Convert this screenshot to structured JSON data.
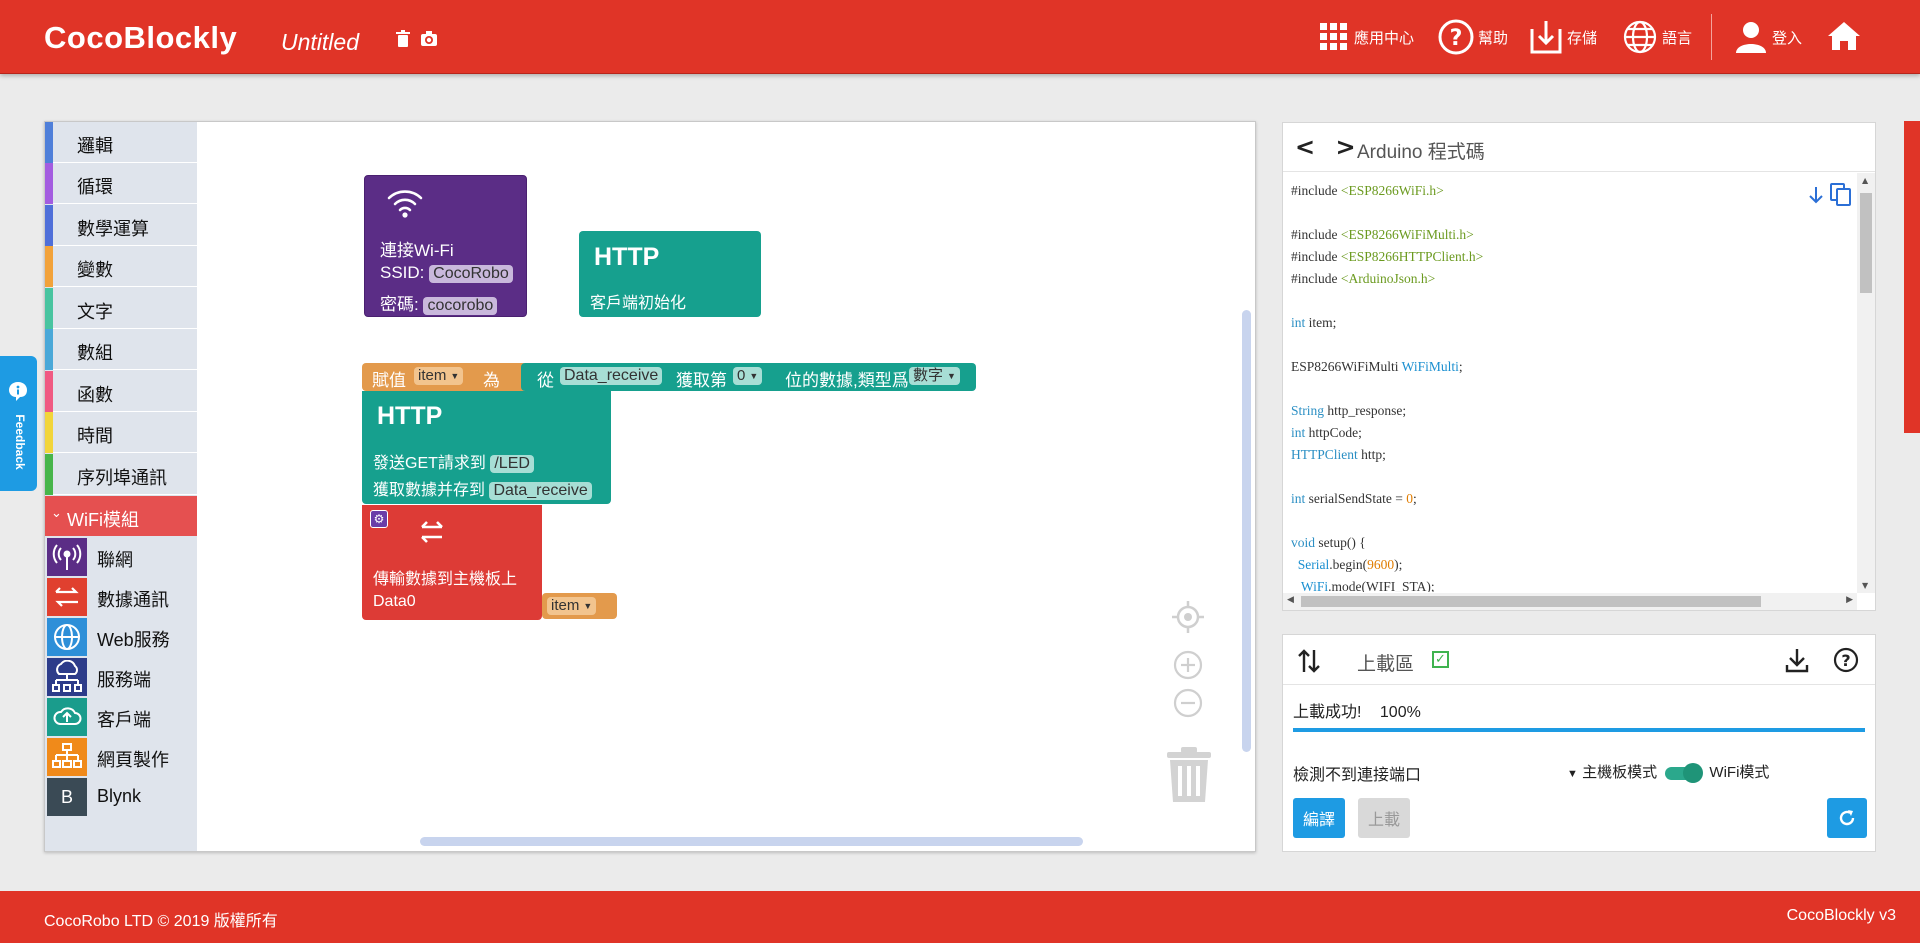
{
  "header": {
    "brand": "CocoBlockly",
    "project_name": "Untitled",
    "nav": {
      "apps": "應用中心",
      "help": "幫助",
      "save": "存儲",
      "language": "語言",
      "login": "登入"
    }
  },
  "feedback": {
    "label": "Feedback"
  },
  "toolbox": {
    "categories": [
      {
        "label": "邏輯",
        "color": "#4f7fd9"
      },
      {
        "label": "循環",
        "color": "#a35ce0"
      },
      {
        "label": "數學運算",
        "color": "#4f6fd9"
      },
      {
        "label": "變數",
        "color": "#f2a23a"
      },
      {
        "label": "文字",
        "color": "#48c4a0"
      },
      {
        "label": "數組",
        "color": "#4aa8d8"
      },
      {
        "label": "函數",
        "color": "#f05a82"
      },
      {
        "label": "時間",
        "color": "#f2d53a"
      },
      {
        "label": "序列埠通訊",
        "color": "#47b54a"
      },
      {
        "label": "WiFi模組",
        "color": "#e55050"
      }
    ],
    "subcategories": [
      {
        "label": "聯網",
        "icon": "antenna-icon",
        "color": "#5b2d86"
      },
      {
        "label": "數據通訊",
        "icon": "exchange-icon",
        "color": "#e0402f"
      },
      {
        "label": "Web服務",
        "icon": "globe-icon",
        "color": "#2e8fd8"
      },
      {
        "label": "服務端",
        "icon": "cloud-network-icon",
        "color": "#2d3c8a"
      },
      {
        "label": "客戶端",
        "icon": "cloud-upload-icon",
        "color": "#1a9c8c"
      },
      {
        "label": "網頁製作",
        "icon": "sitemap-icon",
        "color": "#f08a1a"
      },
      {
        "label": "Blynk",
        "icon": "blynk-icon",
        "color": "#3a4a55"
      }
    ]
  },
  "blocks": {
    "wifi": {
      "title": "連接Wi-Fi",
      "ssid_label": "SSID:",
      "ssid": "CocoRobo",
      "pwd_label": "密碼:",
      "pwd": "cocorobo"
    },
    "http_init": {
      "title": "HTTP",
      "text": "客戶端初始化"
    },
    "assign": {
      "prefix": "賦值",
      "var": "item",
      "mid": "為"
    },
    "getdata": {
      "prefix": "從",
      "src": "Data_receive",
      "mid": "獲取第",
      "index": "0",
      "suffix": "位的數據,類型爲",
      "type": "數字"
    },
    "http_get": {
      "title": "HTTP",
      "line1": "發送GET請求到",
      "path": "/LED",
      "line2": "獲取數據并存到",
      "target": "Data_receive"
    },
    "send": {
      "line1": "傳輸數據到主機板上",
      "channel": "Data0",
      "var": "item"
    }
  },
  "code_panel": {
    "arrows": "< >",
    "title": "Arduino 程式碼",
    "lines": [
      [
        [
          "p",
          "#include "
        ],
        [
          "inc",
          "<ESP8266WiFi.h>"
        ]
      ],
      [],
      [
        [
          "p",
          "#include "
        ],
        [
          "inc",
          "<ESP8266WiFiMulti.h>"
        ]
      ],
      [
        [
          "p",
          "#include "
        ],
        [
          "inc",
          "<ESP8266HTTPClient.h>"
        ]
      ],
      [
        [
          "p",
          "#include "
        ],
        [
          "inc",
          "<ArduinoJson.h>"
        ]
      ],
      [],
      [
        [
          "kw",
          "int"
        ],
        [
          "p",
          " item;"
        ]
      ],
      [],
      [
        [
          "p",
          "ESP8266WiFiMulti "
        ],
        [
          "fn",
          "WiFiMulti"
        ],
        [
          "p",
          ";"
        ]
      ],
      [],
      [
        [
          "kw",
          "String"
        ],
        [
          "p",
          " http_response;"
        ]
      ],
      [
        [
          "kw",
          "int"
        ],
        [
          "p",
          " httpCode;"
        ]
      ],
      [
        [
          "kw",
          "HTTPClient"
        ],
        [
          "p",
          " http;"
        ]
      ],
      [],
      [
        [
          "kw",
          "int"
        ],
        [
          "p",
          " serialSendState = "
        ],
        [
          "num",
          "0"
        ],
        [
          "p",
          ";"
        ]
      ],
      [],
      [
        [
          "kw",
          "void"
        ],
        [
          "p",
          " setup() {"
        ]
      ],
      [
        [
          "p",
          "  "
        ],
        [
          "fn",
          "Serial"
        ],
        [
          "p",
          ".begin("
        ],
        [
          "num",
          "9600"
        ],
        [
          "p",
          ");"
        ]
      ],
      [
        [
          "p",
          "   "
        ],
        [
          "fn",
          "WiFi"
        ],
        [
          "p",
          ".mode(WIFI_STA);"
        ]
      ]
    ]
  },
  "upload_panel": {
    "title": "上載區",
    "status": "上載成功!",
    "progress_text": "100%",
    "progress": 1.0,
    "port_status": "檢測不到連接端口",
    "mode_left": "主機板模式",
    "mode_right": "WiFi模式",
    "compile": "編譯",
    "upload": "上載"
  },
  "footer": {
    "copyright": "CocoRobo LTD © 2019 版權所有",
    "version": "CocoBlockly v3"
  },
  "colors": {
    "accent": "#e03427",
    "blue": "#1e9be3",
    "wifi_block": "#5b2d86",
    "http_block": "#16a08e",
    "var_block": "#e39a4c",
    "send_block": "#dd3b36"
  }
}
